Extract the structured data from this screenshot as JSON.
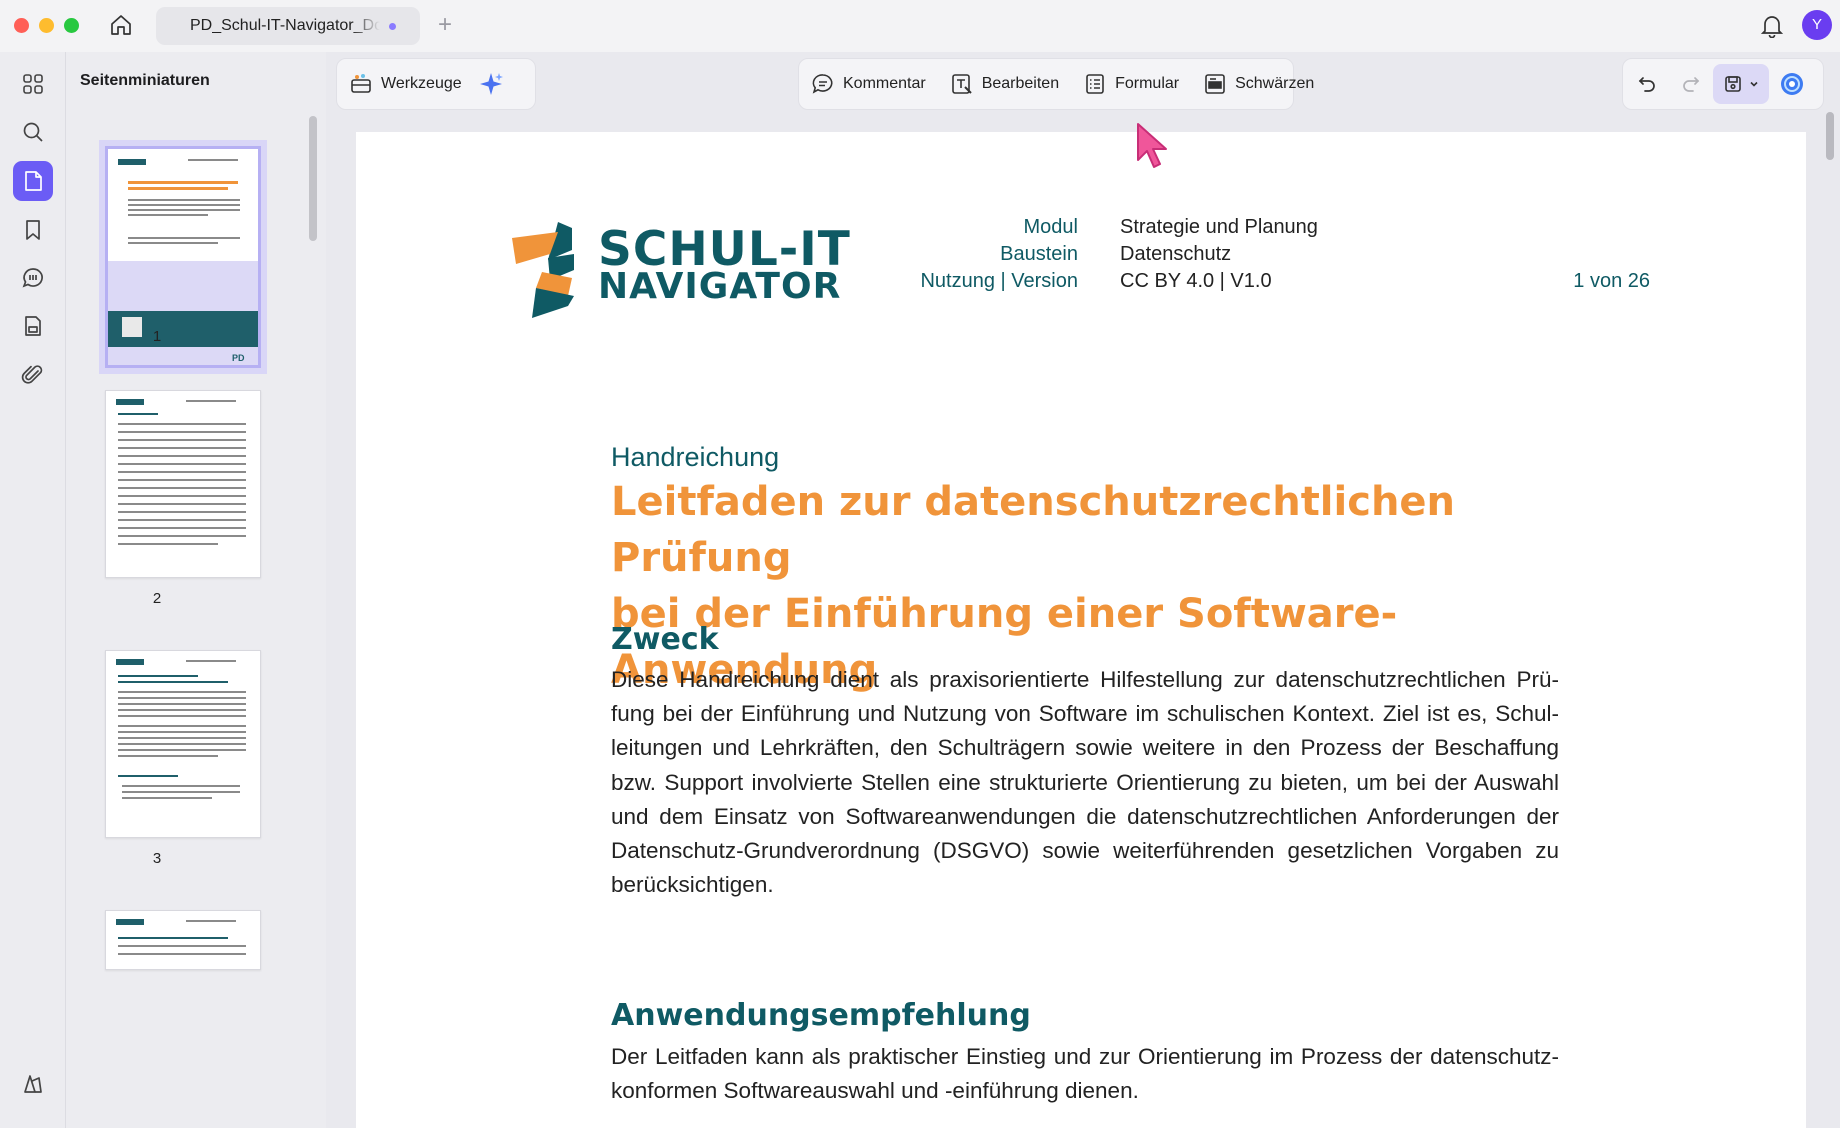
{
  "titlebar": {
    "tab_title": "PD_Schul-IT-Navigator_Dokument",
    "avatar_initial": "Y"
  },
  "sidebar": {
    "panel_title": "Seitenminiaturen",
    "rail_items": [
      "grid-icon",
      "search-icon",
      "pages-icon",
      "bookmark-icon",
      "comment-icon",
      "form-icon",
      "attachment-icon",
      "layers-icon"
    ],
    "thumbnails": [
      {
        "page": "1"
      },
      {
        "page": "2"
      },
      {
        "page": "3"
      }
    ]
  },
  "toolbar": {
    "tools_label": "Werkzeuge",
    "comment_label": "Kommentar",
    "edit_label": "Bearbeiten",
    "form_label": "Formular",
    "redact_label": "Schwärzen"
  },
  "document": {
    "logo_line1": "SCHUL-IT",
    "logo_line2": "NAVIGATOR",
    "meta": {
      "module_label": "Modul",
      "module_value": "Strategie und Planung",
      "building_block_label": "Baustein",
      "building_block_value": "Datenschutz",
      "usage_label": "Nutzung | Version",
      "usage_value": "CC BY 4.0 | V1.0",
      "page_count": "1 von 26"
    },
    "kicker": "Handreichung",
    "title_line1": "Leitfaden zur datenschutzrechtlichen Prüfung",
    "title_line2": "bei der Einführung einer Software-Anwendung",
    "section1_heading": "Zweck",
    "section1_text": "Diese Handreichung dient als praxisorientierte Hilfestellung zur datenschutzrechtlichen Prü­fung bei der Einführung und Nutzung von Software im schulischen Kontext. Ziel ist es, Schul­leitungen und Lehrkräften, den Schulträgern sowie weitere in den Prozess der Beschaffung bzw. Support involvierte Stellen eine strukturierte Orientierung zu bieten, um bei der Auswahl und dem Einsatz von Softwareanwendungen die datenschutzrechtlichen Anforderungen der Datenschutz-Grundverordnung (DSGVO) sowie weiterführenden gesetzlichen Vorgaben zu berücksichtigen.",
    "section2_heading": "Anwendungsempfehlung",
    "section2_text": "Der Leitfaden kann als praktischer Einstieg und zur Orientierung im Prozess der datenschutz­konformen Softwareauswahl und -einführung dienen."
  },
  "colors": {
    "brand_teal": "#0f5a64",
    "brand_orange": "#f0943a",
    "accent_purple": "#6b5cf5"
  }
}
